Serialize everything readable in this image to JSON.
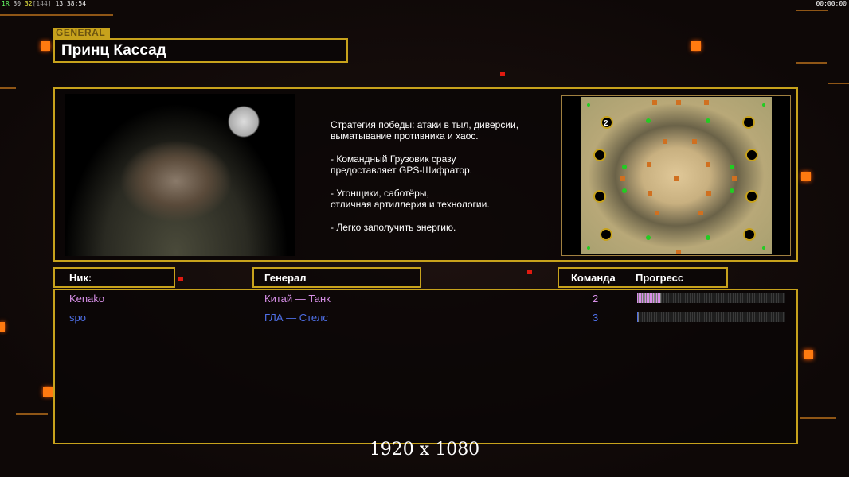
{
  "hud": {
    "r": "1R",
    "a": "30",
    "b": "32",
    "c": "[144]",
    "time": "13:38:54",
    "clock": "00:00:00"
  },
  "general_label": "GENERAL",
  "title": "Принц Кассад",
  "description": "Стратегия победы: атаки в тыл, диверсии,\n выматывание противника и хаос.\n\n- Командный Грузовик сразу\nпредоставляет GPS-Шифратор.\n\n- Угонщики, саботёры,\nотличная артиллерия и технологии.\n\n- Легко заполучить энергию.",
  "map": {
    "player_slot": "2"
  },
  "headers": {
    "nick": "Ник:",
    "general": "Генерал",
    "team": "Команда",
    "progress": "Прогресс"
  },
  "players": [
    {
      "nick": "Kenako",
      "general": "Китай — Танк",
      "team": "2",
      "progress": 16,
      "color": "#d890e8"
    },
    {
      "nick": "spo",
      "general": "ГЛА — Стелс",
      "team": "3",
      "progress": 1,
      "color": "#4f70e8"
    }
  ],
  "resolution": "1920 x 1080"
}
